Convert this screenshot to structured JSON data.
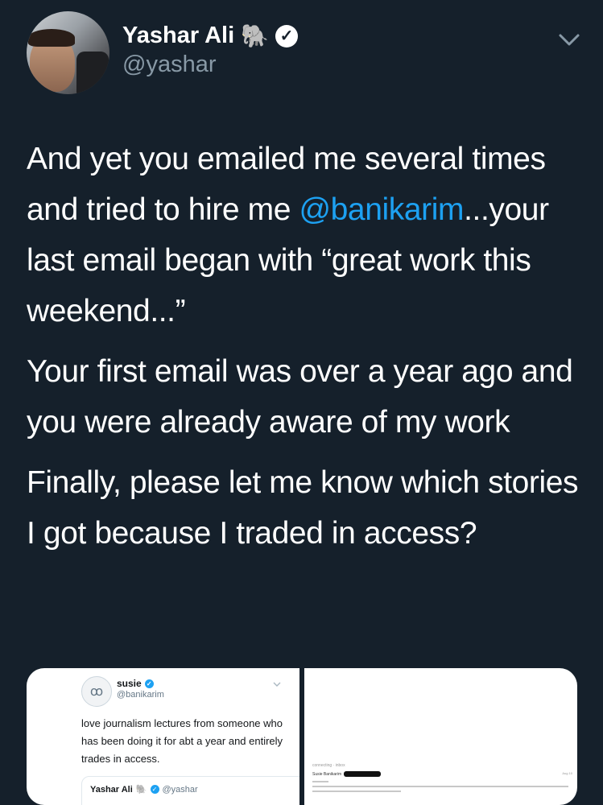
{
  "header": {
    "display_name": "Yashar Ali",
    "name_emoji": "🐘",
    "verified_glyph": "✓",
    "handle": "@yashar",
    "chevron_icon": "chevron-down-icon"
  },
  "tweet": {
    "p1_a": "And yet you emailed me several times and tried to hire me ",
    "p1_mention": "@banikarim",
    "p1_b": "...your last email began with “great work this weekend...”",
    "p2": "Your first email was over a year ago and you were already aware of my work",
    "p3": "Finally, please let me know which stories I got because I traded in access?"
  },
  "media": {
    "left": {
      "avatar_glyph": "ꚙ",
      "name": "susie",
      "verified_glyph": "✓",
      "handle": "@banikarim",
      "text": "love journalism lectures from someone who has been doing it for  abt a year and entirely trades in access.",
      "quoted": {
        "name": "Yashar Ali",
        "emoji": "🐘",
        "verified_glyph": "✓",
        "handle": "@yashar"
      }
    },
    "right": {
      "label": "connecting · inbox",
      "sender": "Susie Banikarim",
      "date": "Aug 10"
    }
  },
  "colors": {
    "background": "#15202b",
    "text": "#ffffff",
    "secondary": "#8899a6",
    "link": "#1da1f2"
  }
}
